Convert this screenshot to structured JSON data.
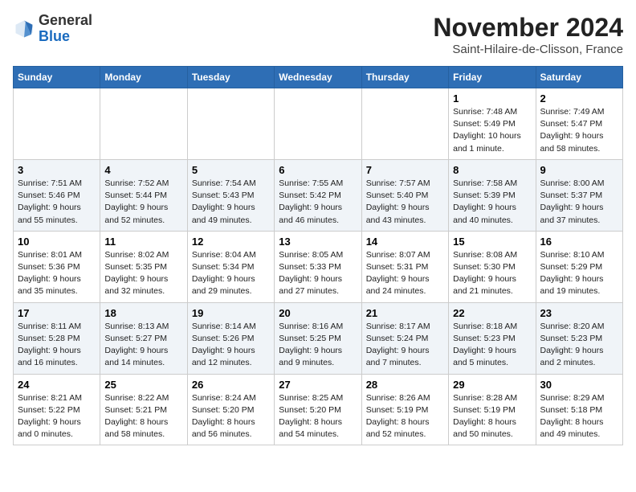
{
  "logo": {
    "general": "General",
    "blue": "Blue"
  },
  "title": {
    "month": "November 2024",
    "location": "Saint-Hilaire-de-Clisson, France"
  },
  "headers": [
    "Sunday",
    "Monday",
    "Tuesday",
    "Wednesday",
    "Thursday",
    "Friday",
    "Saturday"
  ],
  "weeks": [
    [
      {
        "day": "",
        "info": ""
      },
      {
        "day": "",
        "info": ""
      },
      {
        "day": "",
        "info": ""
      },
      {
        "day": "",
        "info": ""
      },
      {
        "day": "",
        "info": ""
      },
      {
        "day": "1",
        "info": "Sunrise: 7:48 AM\nSunset: 5:49 PM\nDaylight: 10 hours and 1 minute."
      },
      {
        "day": "2",
        "info": "Sunrise: 7:49 AM\nSunset: 5:47 PM\nDaylight: 9 hours and 58 minutes."
      }
    ],
    [
      {
        "day": "3",
        "info": "Sunrise: 7:51 AM\nSunset: 5:46 PM\nDaylight: 9 hours and 55 minutes."
      },
      {
        "day": "4",
        "info": "Sunrise: 7:52 AM\nSunset: 5:44 PM\nDaylight: 9 hours and 52 minutes."
      },
      {
        "day": "5",
        "info": "Sunrise: 7:54 AM\nSunset: 5:43 PM\nDaylight: 9 hours and 49 minutes."
      },
      {
        "day": "6",
        "info": "Sunrise: 7:55 AM\nSunset: 5:42 PM\nDaylight: 9 hours and 46 minutes."
      },
      {
        "day": "7",
        "info": "Sunrise: 7:57 AM\nSunset: 5:40 PM\nDaylight: 9 hours and 43 minutes."
      },
      {
        "day": "8",
        "info": "Sunrise: 7:58 AM\nSunset: 5:39 PM\nDaylight: 9 hours and 40 minutes."
      },
      {
        "day": "9",
        "info": "Sunrise: 8:00 AM\nSunset: 5:37 PM\nDaylight: 9 hours and 37 minutes."
      }
    ],
    [
      {
        "day": "10",
        "info": "Sunrise: 8:01 AM\nSunset: 5:36 PM\nDaylight: 9 hours and 35 minutes."
      },
      {
        "day": "11",
        "info": "Sunrise: 8:02 AM\nSunset: 5:35 PM\nDaylight: 9 hours and 32 minutes."
      },
      {
        "day": "12",
        "info": "Sunrise: 8:04 AM\nSunset: 5:34 PM\nDaylight: 9 hours and 29 minutes."
      },
      {
        "day": "13",
        "info": "Sunrise: 8:05 AM\nSunset: 5:33 PM\nDaylight: 9 hours and 27 minutes."
      },
      {
        "day": "14",
        "info": "Sunrise: 8:07 AM\nSunset: 5:31 PM\nDaylight: 9 hours and 24 minutes."
      },
      {
        "day": "15",
        "info": "Sunrise: 8:08 AM\nSunset: 5:30 PM\nDaylight: 9 hours and 21 minutes."
      },
      {
        "day": "16",
        "info": "Sunrise: 8:10 AM\nSunset: 5:29 PM\nDaylight: 9 hours and 19 minutes."
      }
    ],
    [
      {
        "day": "17",
        "info": "Sunrise: 8:11 AM\nSunset: 5:28 PM\nDaylight: 9 hours and 16 minutes."
      },
      {
        "day": "18",
        "info": "Sunrise: 8:13 AM\nSunset: 5:27 PM\nDaylight: 9 hours and 14 minutes."
      },
      {
        "day": "19",
        "info": "Sunrise: 8:14 AM\nSunset: 5:26 PM\nDaylight: 9 hours and 12 minutes."
      },
      {
        "day": "20",
        "info": "Sunrise: 8:16 AM\nSunset: 5:25 PM\nDaylight: 9 hours and 9 minutes."
      },
      {
        "day": "21",
        "info": "Sunrise: 8:17 AM\nSunset: 5:24 PM\nDaylight: 9 hours and 7 minutes."
      },
      {
        "day": "22",
        "info": "Sunrise: 8:18 AM\nSunset: 5:23 PM\nDaylight: 9 hours and 5 minutes."
      },
      {
        "day": "23",
        "info": "Sunrise: 8:20 AM\nSunset: 5:23 PM\nDaylight: 9 hours and 2 minutes."
      }
    ],
    [
      {
        "day": "24",
        "info": "Sunrise: 8:21 AM\nSunset: 5:22 PM\nDaylight: 9 hours and 0 minutes."
      },
      {
        "day": "25",
        "info": "Sunrise: 8:22 AM\nSunset: 5:21 PM\nDaylight: 8 hours and 58 minutes."
      },
      {
        "day": "26",
        "info": "Sunrise: 8:24 AM\nSunset: 5:20 PM\nDaylight: 8 hours and 56 minutes."
      },
      {
        "day": "27",
        "info": "Sunrise: 8:25 AM\nSunset: 5:20 PM\nDaylight: 8 hours and 54 minutes."
      },
      {
        "day": "28",
        "info": "Sunrise: 8:26 AM\nSunset: 5:19 PM\nDaylight: 8 hours and 52 minutes."
      },
      {
        "day": "29",
        "info": "Sunrise: 8:28 AM\nSunset: 5:19 PM\nDaylight: 8 hours and 50 minutes."
      },
      {
        "day": "30",
        "info": "Sunrise: 8:29 AM\nSunset: 5:18 PM\nDaylight: 8 hours and 49 minutes."
      }
    ]
  ]
}
